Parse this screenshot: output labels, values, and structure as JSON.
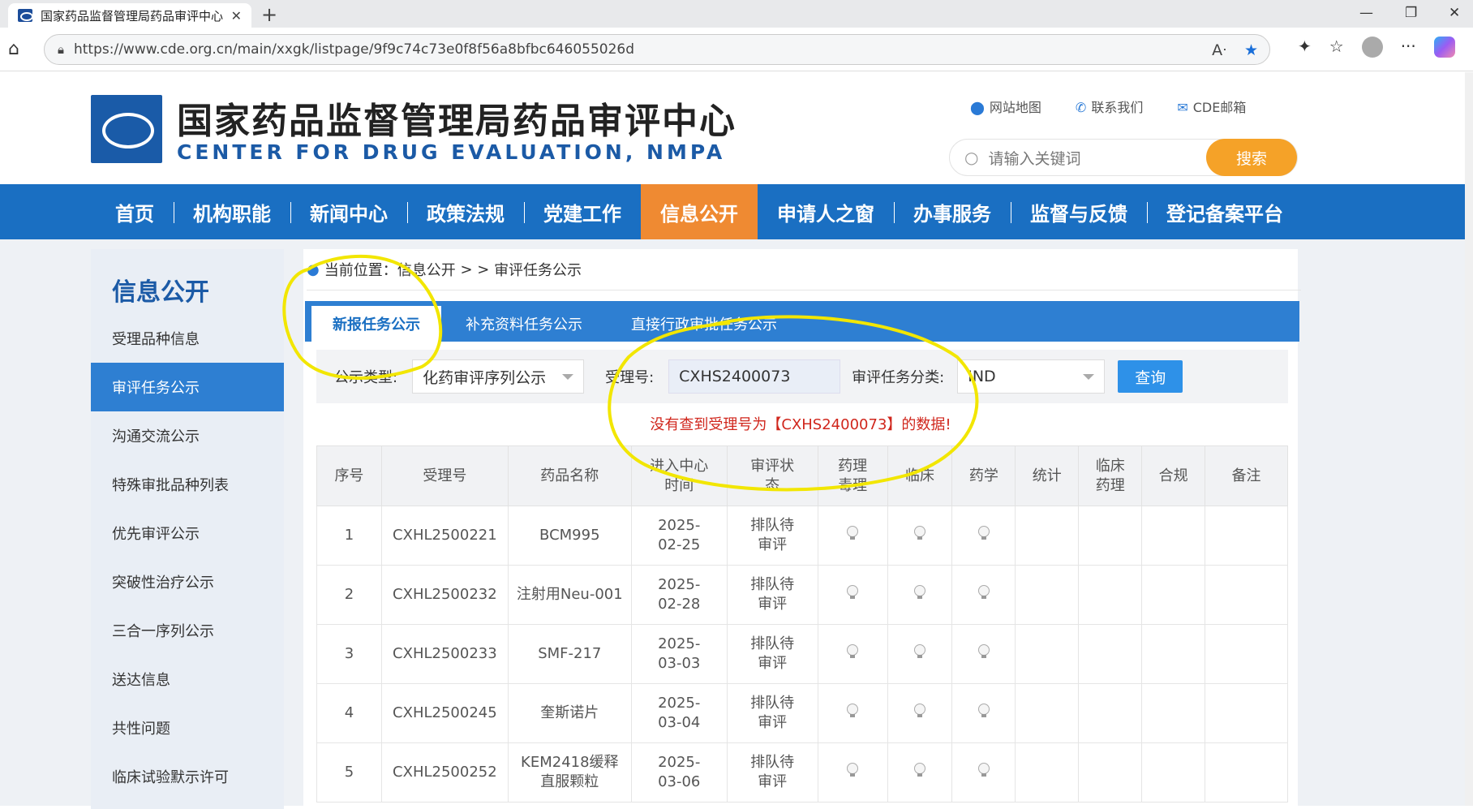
{
  "browser": {
    "tab_title": "国家药品监督管理局药品审评中心",
    "url": "https://www.cde.org.cn/main/xxgk/listpage/9f9c74c73e0f8f56a8bfbc646055026d"
  },
  "header": {
    "title_cn": "国家药品监督管理局药品审评中心",
    "title_en": "CENTER FOR DRUG EVALUATION, NMPA",
    "links": [
      "网站地图",
      "联系我们",
      "CDE邮箱"
    ],
    "search_placeholder": "请输入关键词",
    "search_button": "搜索"
  },
  "nav": {
    "items": [
      "首页",
      "机构职能",
      "新闻中心",
      "政策法规",
      "党建工作",
      "信息公开",
      "申请人之窗",
      "办事服务",
      "监督与反馈",
      "登记备案平台"
    ],
    "active": "信息公开"
  },
  "sidebar": {
    "title": "信息公开",
    "items": [
      "受理品种信息",
      "审评任务公示",
      "沟通交流公示",
      "特殊审批品种列表",
      "优先审评公示",
      "突破性治疗公示",
      "三合一序列公示",
      "送达信息",
      "共性问题",
      "临床试验默示许可"
    ],
    "active": "审评任务公示"
  },
  "breadcrumb": {
    "prefix": "当前位置：",
    "section": "信息公开",
    "sep": " > > ",
    "current": "审评任务公示"
  },
  "tabs": [
    "新报任务公示",
    "补充资料任务公示",
    "直接行政审批任务公示"
  ],
  "filter": {
    "type_label": "公示类型:",
    "type_value": "化药审评序列公示",
    "acceptance_label": "受理号:",
    "acceptance_value": "CXHS2400073",
    "category_label": "审评任务分类:",
    "category_value": "IND",
    "query_button": "查询"
  },
  "message": "没有查到受理号为【CXHS2400073】的数据!",
  "table": {
    "headers": [
      "序号",
      "受理号",
      "药品名称",
      "进入中心时间",
      "审评状态",
      "药理毒理",
      "临床",
      "药学",
      "统计",
      "临床药理",
      "合规",
      "备注"
    ],
    "rows": [
      {
        "no": "1",
        "acc": "CXHL2500221",
        "name": "BCM995",
        "date": "2025-02-25",
        "status": "排队待审评"
      },
      {
        "no": "2",
        "acc": "CXHL2500232",
        "name": "注射用Neu-001",
        "date": "2025-02-28",
        "status": "排队待审评"
      },
      {
        "no": "3",
        "acc": "CXHL2500233",
        "name": "SMF-217",
        "date": "2025-03-03",
        "status": "排队待审评"
      },
      {
        "no": "4",
        "acc": "CXHL2500245",
        "name": "奎斯诺片",
        "date": "2025-03-04",
        "status": "排队待审评"
      },
      {
        "no": "5",
        "acc": "CXHL2500252",
        "name": "KEM2418缓释直服颗粒",
        "date": "2025-03-06",
        "status": "排队待审评"
      }
    ]
  },
  "colors": {
    "nav_blue": "#1a6fc2",
    "nav_active": "#ef8a32",
    "search_orange": "#f5a228",
    "error_red": "#d0261c",
    "annotation_yellow": "#f2e600"
  }
}
